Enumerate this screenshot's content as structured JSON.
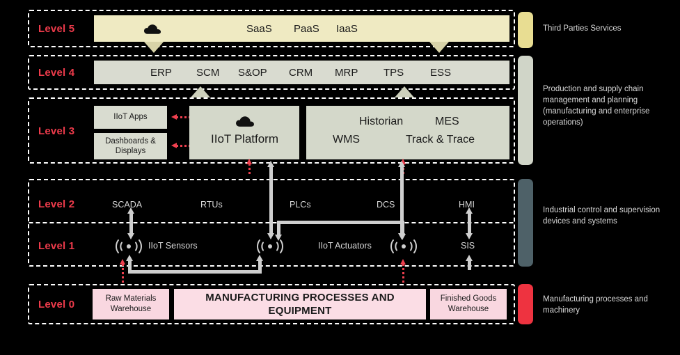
{
  "levels": {
    "l5": "Level 5",
    "l4": "Level 4",
    "l3": "Level 3",
    "l2": "Level 2",
    "l1": "Level 1",
    "l0": "Level 0"
  },
  "level5": {
    "icon": "cloud-icon",
    "items": [
      "SaaS",
      "PaaS",
      "IaaS"
    ]
  },
  "level4": {
    "items": [
      "ERP",
      "SCM",
      "S&OP",
      "CRM",
      "MRP",
      "TPS",
      "ESS"
    ]
  },
  "level3": {
    "apps": "IIoT Apps",
    "dashboards": "Dashboards & Displays",
    "platform": "IIoT Platform",
    "platform_icon": "cloud-icon",
    "right_items": [
      "Historian",
      "MES",
      "WMS",
      "Track & Trace"
    ]
  },
  "level2": {
    "items": [
      "SCADA",
      "RTUs",
      "PLCs",
      "DCS",
      "HMI"
    ]
  },
  "level1": {
    "items": [
      "IIoT Sensors",
      "IIoT Actuators",
      "SIS"
    ],
    "sensor_icon": "wireless-signal-icon"
  },
  "level0": {
    "raw": "Raw Materials Warehouse",
    "main": "MANUFACTURING PROCESSES AND EQUIPMENT",
    "finished": "Finished Goods Warehouse"
  },
  "sidebar": [
    {
      "color": "#e8dd92",
      "text": "Third Parties Services"
    },
    {
      "color": "#d0d5c8",
      "text": "Production and supply chain management and planning (manufacturing and enterprise operations)"
    },
    {
      "color": "#4e6168",
      "text": "Industrial control and supervision devices and systems"
    },
    {
      "color": "#ee3340",
      "text": "Manufacturing processes and machinery"
    }
  ],
  "colors": {
    "level5_bar": "#efeac2",
    "level4_bar": "#d9dbd0",
    "level3_bar": "#d4d8ca",
    "level0_box": "#f9d7e0",
    "accent_red": "#ee3b4b",
    "arrow_grey": "#cfcfcf"
  }
}
